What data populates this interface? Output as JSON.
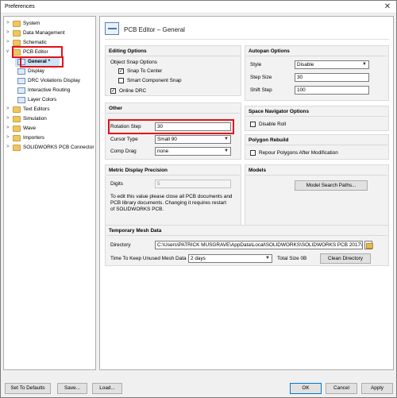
{
  "window": {
    "title": "Preferences",
    "close_glyph": "✕"
  },
  "tree": {
    "items": [
      {
        "label": "System",
        "expander": ">",
        "icon": "folder-icon"
      },
      {
        "label": "Data Management",
        "expander": ">",
        "icon": "folder-icon"
      },
      {
        "label": "Schematic",
        "expander": ">",
        "icon": "folder-icon"
      },
      {
        "label": "PCB Editor",
        "expander": "v",
        "icon": "folder-icon"
      },
      {
        "label": "General *",
        "expander": "",
        "icon": "page-icon"
      },
      {
        "label": "Display",
        "expander": "",
        "icon": "page-icon"
      },
      {
        "label": "DRC Violations Display",
        "expander": "",
        "icon": "page-icon"
      },
      {
        "label": "Interactive Routing",
        "expander": "",
        "icon": "page-icon"
      },
      {
        "label": "Layer Colors",
        "expander": "",
        "icon": "page-icon"
      },
      {
        "label": "Text Editors",
        "expander": ">",
        "icon": "folder-icon"
      },
      {
        "label": "Simulation",
        "expander": ">",
        "icon": "folder-icon"
      },
      {
        "label": "Wave",
        "expander": ">",
        "icon": "folder-icon"
      },
      {
        "label": "Importers",
        "expander": ">",
        "icon": "folder-icon"
      },
      {
        "label": "SOLIDWORKS PCB Connector",
        "expander": ">",
        "icon": "folder-icon"
      }
    ]
  },
  "content": {
    "header_title": "PCB Editor – General",
    "editing_options": {
      "title": "Editing Options",
      "object_snap_label": "Object Snap Options",
      "snap_to_center": "Snap To Center",
      "smart_component_snap": "Smart Component Snap",
      "online_drc": "Online DRC",
      "check_glyph": "✓"
    },
    "other": {
      "title": "Other",
      "rotation_step_label": "Rotation Step",
      "rotation_step_value": "30",
      "cursor_type_label": "Cursor Type",
      "cursor_type_value": "Small 90",
      "comp_drag_label": "Comp Drag",
      "comp_drag_value": "none"
    },
    "metric": {
      "title": "Metric Display Precision",
      "digits_label": "Digits",
      "digits_value": "5",
      "note_line1": "To edit this value please close all PCB documents and",
      "note_line2": "PCB library documents. Changing it requires restart",
      "note_line3": "of SOLIDWORKS PCB."
    },
    "autopan": {
      "title": "Autopan Options",
      "style_label": "Style",
      "style_value": "Disable",
      "step_size_label": "Step Size",
      "step_size_value": "30",
      "shift_step_label": "Shift Step",
      "shift_step_value": "100"
    },
    "space_navigator": {
      "title": "Space Navigator Options",
      "disable_roll": "Disable Roll"
    },
    "polygon_rebuild": {
      "title": "Polygon Rebuild",
      "repour": "Repour Polygons After Modification"
    },
    "models": {
      "title": "Models",
      "button": "Model Search Paths..."
    },
    "temp_mesh": {
      "title": "Temporary Mesh Data",
      "directory_label": "Directory",
      "directory_value": "C:\\Users\\PATRICK MUSGRAVE\\AppData\\Local\\SOLIDWORKS\\SOLIDWORKS PCB 2017\\Mesh",
      "keep_label": "Time To Keep Unused Mesh Data",
      "keep_value": "2 days",
      "total_size": "Total Size 0B",
      "clean_button": "Clean Directory"
    },
    "dropdown_arrow": "▼"
  },
  "footer": {
    "set_defaults": "Set To Defaults",
    "save": "Save...",
    "load": "Load...",
    "ok": "OK",
    "cancel": "Cancel",
    "apply": "Apply"
  },
  "colors": {
    "highlight_red": "#e3101a",
    "selection": "#cce4f7",
    "primary_border": "#0078d7"
  }
}
